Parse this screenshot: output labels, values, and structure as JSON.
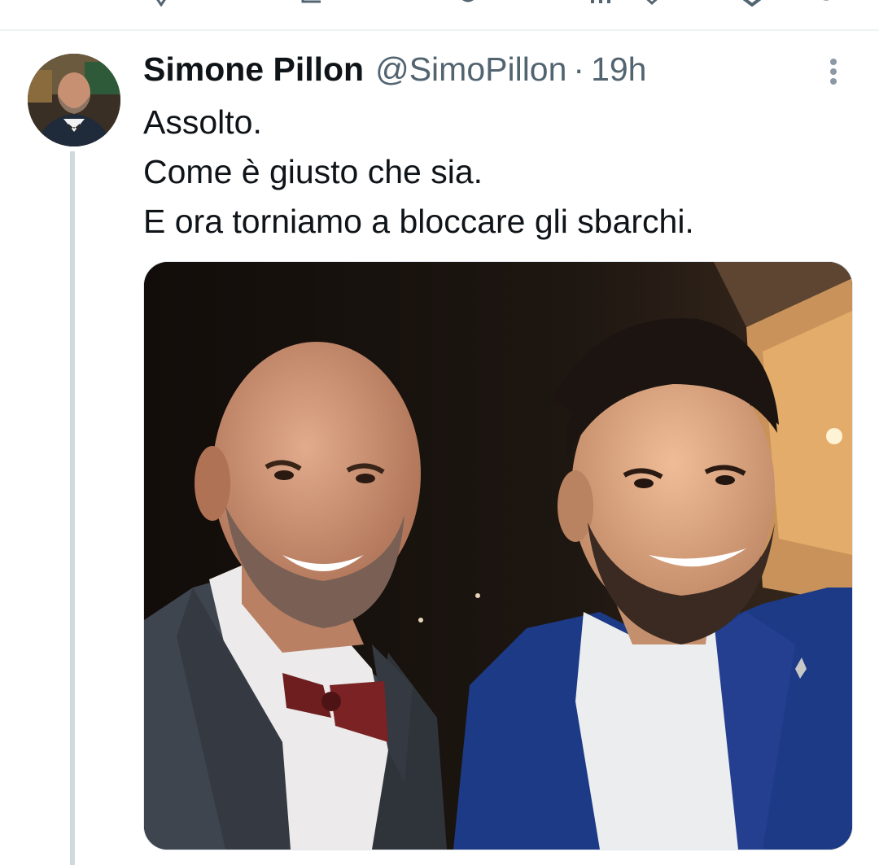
{
  "tweet": {
    "author": {
      "display_name": "Simone Pillon",
      "handle": "@SimoPillon"
    },
    "separator": "·",
    "time": "19h",
    "text_lines": [
      "Assolto.",
      "Come è giusto che sia.",
      "E ora torniamo a bloccare gli sbarchi."
    ],
    "media": {
      "kind": "photo",
      "subjects": 2
    }
  },
  "icons": {
    "more": "more-vertical-icon",
    "previous_actions": [
      "reply-icon",
      "retweet-icon",
      "like-icon",
      "views-icon",
      "share-icon",
      "bookmark-icon",
      "more-icon"
    ]
  },
  "colors": {
    "primary_text": "#0f1419",
    "secondary_text": "#536471",
    "thread_line": "#cfd9de",
    "divider": "#eff3f4"
  }
}
